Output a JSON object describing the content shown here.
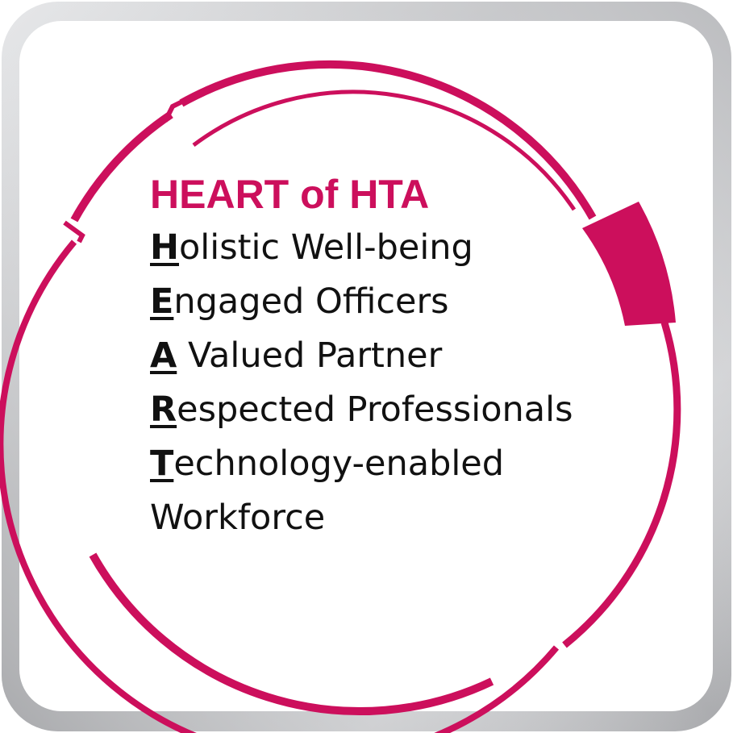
{
  "heading": {
    "title": "HEART of HTA"
  },
  "acronym": {
    "items": [
      {
        "initial": "H",
        "rest": "olistic Well-being"
      },
      {
        "initial": "E",
        "rest": "ngaged Officers"
      },
      {
        "initial": "A",
        "rest": " Valued Partner"
      },
      {
        "initial": "R",
        "rest": "espected Professionals"
      },
      {
        "initial": "T",
        "rest": "echnology-enabled"
      }
    ],
    "continuation": "Workforce"
  },
  "colors": {
    "accent": "#CC0F5C",
    "text": "#111111",
    "frame_light": "#ECECEE",
    "frame_dark": "#A9AAAD",
    "panel": "#FFFFFF"
  }
}
